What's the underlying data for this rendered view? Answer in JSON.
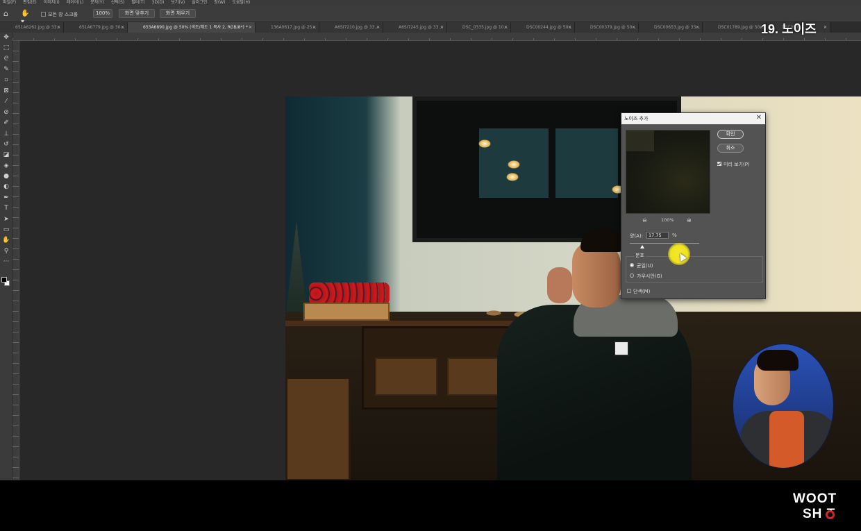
{
  "menubar": {
    "items": [
      "파일(F)",
      "편집(E)",
      "이미지(I)",
      "레이어(L)",
      "문자(Y)",
      "선택(S)",
      "필터(T)",
      "3D(D)",
      "보기(V)",
      "플러그인",
      "창(W)",
      "도움말(H)"
    ]
  },
  "options": {
    "scroll_all_label": "모든 창 스크롤",
    "zoom_value": "100%",
    "fit_screen_label": "화면 맞추기",
    "fill_screen_label": "화면 채우기"
  },
  "tabs": [
    "651A6262.jpg @ 33...",
    "651A6779.jpg @ 30...",
    "653A6890.jpg @ 50% (색조/채도 1 복사 2, RGB/8*) *",
    "136A0617.jpg @ 25...",
    "A6SI7210.jpg @ 33...",
    "A6SI7245.jpg @ 33...",
    "DSC_0335.jpg @ 10...",
    "DSC00244.jpg @ 50...",
    "DSC00379.jpg @ 50...",
    "DSC00653.jpg @ 33...",
    "DSC01789.jpg @ 50...",
    "DSC097..."
  ],
  "ruler_ticks": [
    "2000",
    "1900",
    "1800",
    "1700",
    "1600",
    "1500",
    "1400",
    "1300",
    "1200",
    "1100",
    "1000",
    "900",
    "800",
    "700",
    "600",
    "500",
    "400",
    "300",
    "200",
    "100",
    "0",
    "100",
    "200",
    "300",
    "400",
    "500",
    "600",
    "700",
    "800",
    "900",
    "1000",
    "1100",
    "1200",
    "1300",
    "1400",
    "1500",
    "1600",
    "1700",
    "1800",
    "1900",
    "2000",
    "2100",
    "2200",
    "2300",
    "2400",
    "2500",
    "2600",
    "2700",
    "2800",
    "2900",
    "3000",
    "3100",
    "3200",
    "3300",
    "3400",
    "3500",
    "3600",
    "3700",
    "3800",
    "3900",
    "4000"
  ],
  "episode_title": "19. 노이즈",
  "dialog": {
    "title": "노이즈 추가",
    "ok_label": "확인",
    "cancel_label": "취소",
    "preview_label": "미리 보기(P)",
    "preview_checked": true,
    "zoom_value": "100%",
    "amount_label": "양(A):",
    "amount_value": "17.75",
    "amount_unit": "%",
    "amount_slider_fraction": 0.1775,
    "distribution_label": "분포",
    "radio_uniform": "균일(U)",
    "radio_gaussian": "가우시안(G)",
    "selected_distribution": "uniform",
    "monochrome_label": "단색(M)",
    "monochrome_checked": false
  },
  "logo": {
    "line1": "WOOT",
    "line2": "SH T"
  },
  "colors": {
    "highlight_cursor": "#efe31f",
    "logo_red": "#e02020"
  }
}
